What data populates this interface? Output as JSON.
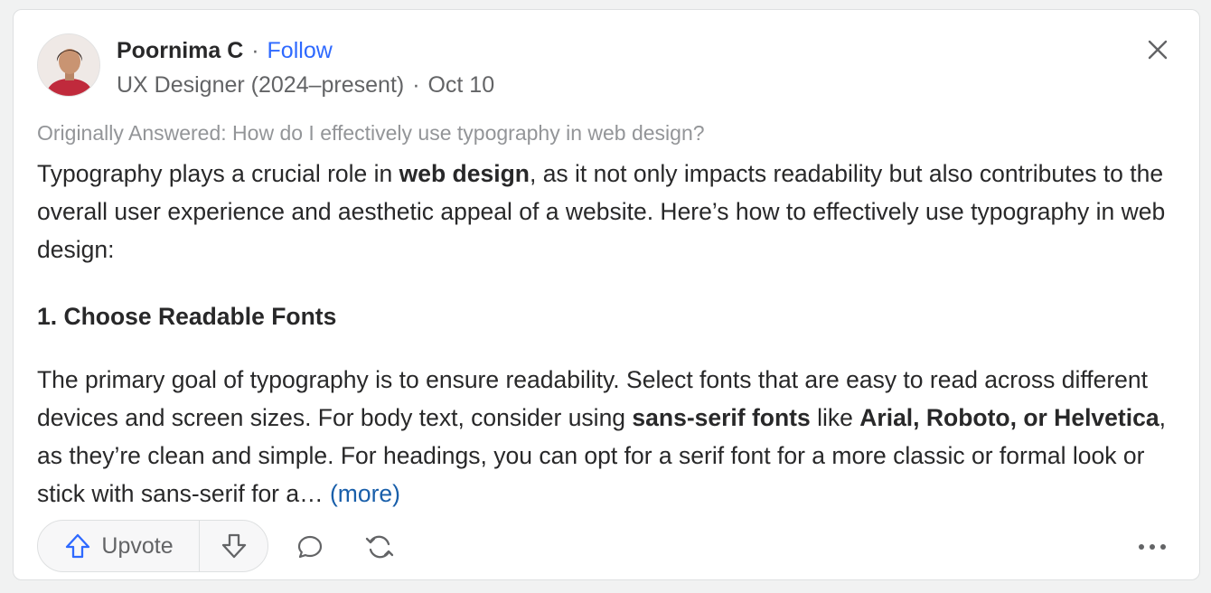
{
  "author": {
    "name": "Poornima C",
    "separator": "·",
    "follow_label": "Follow",
    "credential": "UX Designer (2024–present)",
    "date_separator": "·",
    "date": "Oct 10"
  },
  "originally_answered": "Originally Answered: How do I effectively use typography in web design?",
  "answer": {
    "p1": {
      "before": "Typography plays a crucial role in ",
      "bold": "web design",
      "after": ", as it not only impacts readability but also contributes to the overall user experience and aesthetic appeal of a website. Here’s how to effectively use typography in web design:"
    },
    "heading": "1. Choose Readable Fonts",
    "p2": {
      "t1": "The primary goal of typography is to ensure readability. Select fonts that are easy to read across different devices and screen sizes. For body text, consider using ",
      "b1": "sans-serif fonts",
      "t2": " like ",
      "b2": "Arial, Roboto, or Helvetica",
      "t3": ", as they’re clean and simple. For headings, you can opt for a serif font for a more classic or formal look or stick with sans-serif for a… ",
      "more": "(more)"
    }
  },
  "actions": {
    "upvote_label": "Upvote"
  },
  "icons": {
    "close": "close-icon",
    "upvote": "upvote-arrow-icon",
    "downvote": "downvote-arrow-icon",
    "comment": "comment-icon",
    "share": "share-icon",
    "overflow": "overflow-icon"
  },
  "colors": {
    "accent": "#2e69ff",
    "link": "#195faa",
    "text": "#282829",
    "secondary": "#636466",
    "muted": "#939598"
  }
}
